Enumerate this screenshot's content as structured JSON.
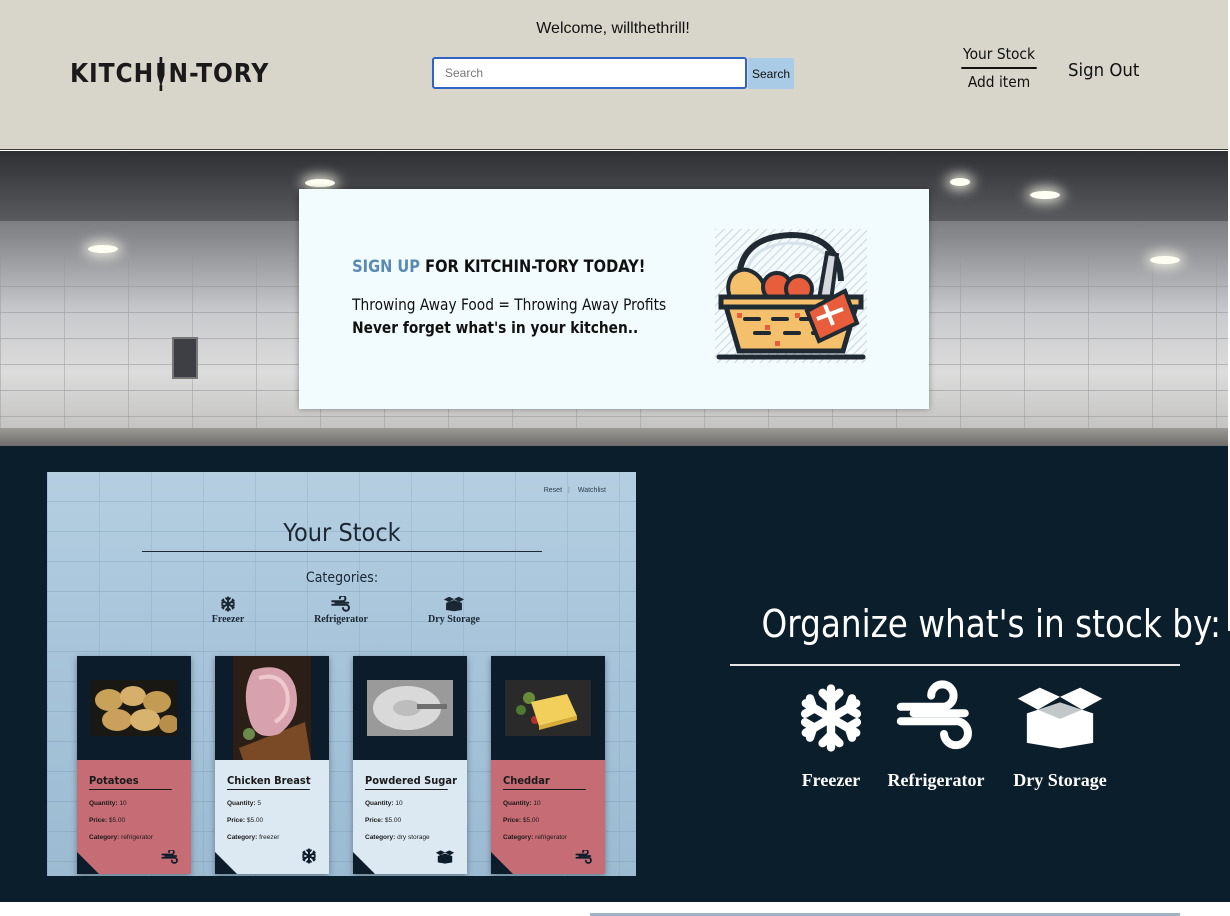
{
  "header": {
    "logo_text_left": "KITCH",
    "logo_text_right": "N-TORY",
    "welcome": "Welcome, willthethrill!",
    "search": {
      "placeholder": "Search",
      "value": "",
      "button_label": "Search"
    },
    "nav": {
      "your_stock": "Your Stock",
      "add_item": "Add item",
      "sign_out": "Sign Out"
    }
  },
  "hero": {
    "signup_link": "SIGN UP",
    "signup_rest": " FOR KITCHIN-TORY TODAY!",
    "line1": "Throwing Away Food = Throwing Away Profits",
    "line2": "Never forget what's in your kitchen.."
  },
  "preview": {
    "links": {
      "reset": "Reset",
      "watchlist": "Watchlist"
    },
    "title": "Your Stock",
    "categories_label": "Categories:",
    "categories": [
      "Freezer",
      "Refrigerator",
      "Dry Storage"
    ],
    "cards": [
      {
        "name": "Potatoes",
        "quantity_label": "Quantity:",
        "quantity": "10",
        "price_label": "Price:",
        "price": "$5.00",
        "category_label": "Category:",
        "category": "refrigerator",
        "icon": "refrigerator-icon",
        "color": "#c56c74"
      },
      {
        "name": "Chicken Breast",
        "quantity_label": "Quantity:",
        "quantity": "5",
        "price_label": "Price:",
        "price": "$5.00",
        "category_label": "Category:",
        "category": "freezer",
        "icon": "snowflake-icon",
        "color": "#dce9f3"
      },
      {
        "name": "Powdered Sugar",
        "quantity_label": "Quantity:",
        "quantity": "10",
        "price_label": "Price:",
        "price": "$5.00",
        "category_label": "Category:",
        "category": "dry storage",
        "icon": "box-icon",
        "color": "#dce9f3"
      },
      {
        "name": "Cheddar",
        "quantity_label": "Quantity:",
        "quantity": "10",
        "price_label": "Price:",
        "price": "$5.00",
        "category_label": "Category:",
        "category": "refrigerator",
        "icon": "refrigerator-icon",
        "color": "#c56c74"
      }
    ]
  },
  "organize": {
    "title": "Organize what's in stock by:",
    "items": [
      {
        "label": "Freezer",
        "icon": "snowflake-icon"
      },
      {
        "label": "Refrigerator",
        "icon": "wind-icon"
      },
      {
        "label": "Dry Storage",
        "icon": "box-icon"
      }
    ]
  },
  "colors": {
    "header_bg": "#d8d5ca",
    "dark_bg": "#0b1e2c",
    "accent_blue": "#5a8ab4",
    "card_red": "#c56c74",
    "card_white": "#dce9f3"
  }
}
